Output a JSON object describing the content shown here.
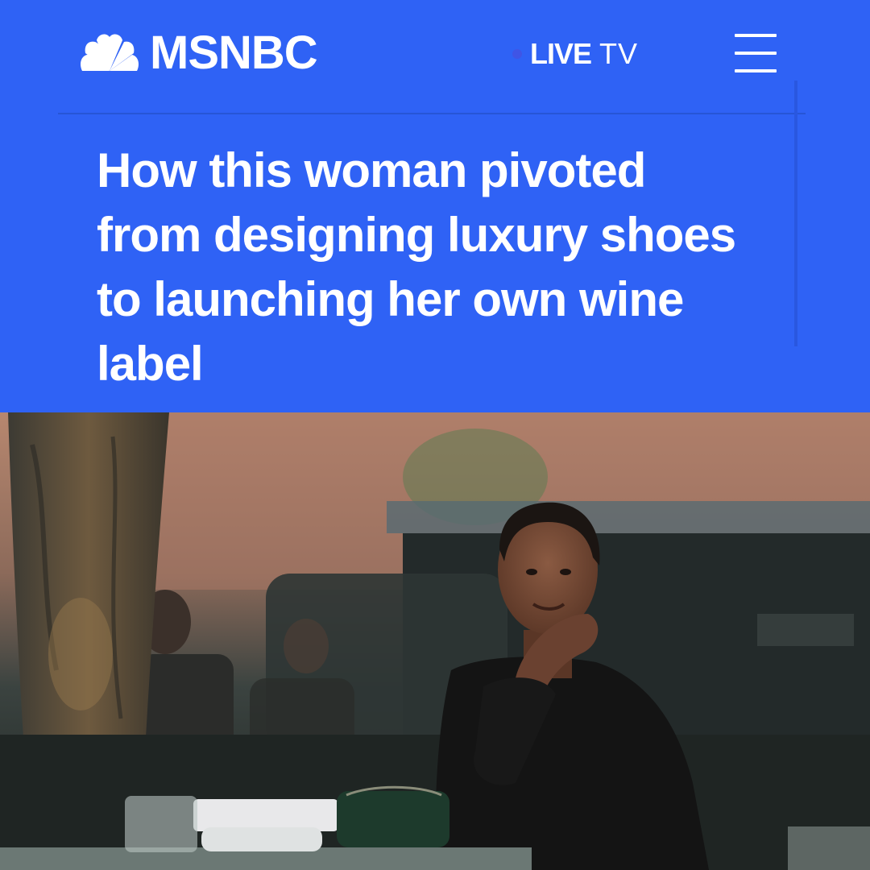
{
  "brand": {
    "name": "MSNBC",
    "logo_icon": "peacock-icon"
  },
  "nav": {
    "live_strong": "LIVE",
    "live_rest": "TV",
    "menu_icon": "hamburger-menu-icon"
  },
  "article": {
    "headline": "How this woman pivoted from designing luxury shoes to launching her own wine label"
  },
  "colors": {
    "brand_blue": "#2f62f5",
    "text": "#ffffff"
  }
}
